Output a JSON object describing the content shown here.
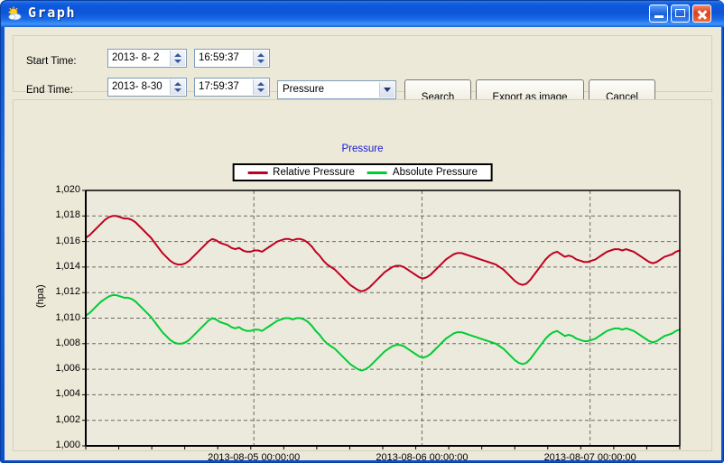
{
  "window": {
    "title": "Graph",
    "icon": "weather-sun-icon",
    "controls": {
      "minimize": "minimize-icon",
      "maximize": "maximize-icon",
      "close": "close-icon"
    }
  },
  "form": {
    "start_label": "Start Time:",
    "end_label": "End Time:",
    "start_date": "2013- 8- 2",
    "start_time": "16:59:37",
    "end_date": "2013- 8-30",
    "end_time": "17:59:37",
    "measure_selected": "Pressure",
    "measure_options": [
      "Pressure"
    ],
    "buttons": {
      "search": "Search",
      "export": "Export as image",
      "cancel": "Cancel"
    }
  },
  "chart_data": {
    "type": "line",
    "title": "Pressure",
    "xlabel": "",
    "ylabel": "(hpa)",
    "ylim": [
      1000,
      1020
    ],
    "ytick_step": 2,
    "yticks": [
      "1,000",
      "1,002",
      "1,004",
      "1,006",
      "1,008",
      "1,010",
      "1,012",
      "1,014",
      "1,016",
      "1,018",
      "1,020"
    ],
    "xticks": [
      "2013-08-05 00:00:00",
      "2013-08-06 00:00:00",
      "2013-08-07 00:00:00"
    ],
    "xtick_fractions": [
      0.283,
      0.566,
      0.849
    ],
    "grid": true,
    "legend_position": "top-center",
    "x_minor_divisions": 18,
    "series": [
      {
        "name": "Relative Pressure",
        "color": "#c00020",
        "values": [
          1016.3,
          1016.5,
          1016.8,
          1017.1,
          1017.4,
          1017.7,
          1017.9,
          1018.0,
          1018.0,
          1017.9,
          1017.8,
          1017.8,
          1017.7,
          1017.5,
          1017.2,
          1016.9,
          1016.6,
          1016.3,
          1015.9,
          1015.5,
          1015.1,
          1014.8,
          1014.5,
          1014.3,
          1014.2,
          1014.2,
          1014.3,
          1014.5,
          1014.8,
          1015.1,
          1015.4,
          1015.7,
          1016.0,
          1016.2,
          1016.1,
          1015.9,
          1015.8,
          1015.7,
          1015.5,
          1015.4,
          1015.5,
          1015.3,
          1015.2,
          1015.2,
          1015.3,
          1015.3,
          1015.2,
          1015.4,
          1015.6,
          1015.8,
          1016.0,
          1016.1,
          1016.2,
          1016.2,
          1016.1,
          1016.2,
          1016.2,
          1016.1,
          1015.9,
          1015.6,
          1015.2,
          1014.9,
          1014.5,
          1014.2,
          1014.0,
          1013.8,
          1013.5,
          1013.2,
          1012.9,
          1012.6,
          1012.4,
          1012.2,
          1012.1,
          1012.2,
          1012.4,
          1012.7,
          1013.0,
          1013.3,
          1013.6,
          1013.8,
          1014.0,
          1014.1,
          1014.1,
          1014.0,
          1013.8,
          1013.6,
          1013.4,
          1013.2,
          1013.1,
          1013.2,
          1013.4,
          1013.7,
          1014.0,
          1014.3,
          1014.6,
          1014.8,
          1015.0,
          1015.1,
          1015.1,
          1015.0,
          1014.9,
          1014.8,
          1014.7,
          1014.6,
          1014.5,
          1014.4,
          1014.3,
          1014.2,
          1014.0,
          1013.8,
          1013.5,
          1013.2,
          1012.9,
          1012.7,
          1012.6,
          1012.7,
          1013.0,
          1013.4,
          1013.8,
          1014.2,
          1014.6,
          1014.9,
          1015.1,
          1015.2,
          1015.0,
          1014.8,
          1014.9,
          1014.8,
          1014.6,
          1014.5,
          1014.4,
          1014.4,
          1014.5,
          1014.6,
          1014.8,
          1015.0,
          1015.2,
          1015.3,
          1015.4,
          1015.4,
          1015.3,
          1015.4,
          1015.3,
          1015.2,
          1015.0,
          1014.8,
          1014.6,
          1014.4,
          1014.3,
          1014.4,
          1014.6,
          1014.8,
          1014.9,
          1015.0,
          1015.2,
          1015.3
        ]
      },
      {
        "name": "Absolute Pressure",
        "color": "#00cc33",
        "values": [
          1010.2,
          1010.4,
          1010.7,
          1011.0,
          1011.3,
          1011.5,
          1011.7,
          1011.8,
          1011.8,
          1011.7,
          1011.6,
          1011.6,
          1011.5,
          1011.3,
          1011.0,
          1010.7,
          1010.4,
          1010.1,
          1009.7,
          1009.3,
          1008.9,
          1008.6,
          1008.3,
          1008.1,
          1008.0,
          1008.0,
          1008.1,
          1008.3,
          1008.6,
          1008.9,
          1009.2,
          1009.5,
          1009.8,
          1010.0,
          1009.9,
          1009.7,
          1009.6,
          1009.5,
          1009.3,
          1009.2,
          1009.3,
          1009.1,
          1009.0,
          1009.0,
          1009.1,
          1009.1,
          1009.0,
          1009.2,
          1009.4,
          1009.6,
          1009.8,
          1009.9,
          1010.0,
          1010.0,
          1009.9,
          1010.0,
          1010.0,
          1009.9,
          1009.7,
          1009.4,
          1009.0,
          1008.7,
          1008.3,
          1008.0,
          1007.8,
          1007.6,
          1007.3,
          1007.0,
          1006.7,
          1006.4,
          1006.2,
          1006.0,
          1005.9,
          1006.0,
          1006.2,
          1006.5,
          1006.8,
          1007.1,
          1007.4,
          1007.6,
          1007.8,
          1007.9,
          1007.9,
          1007.8,
          1007.6,
          1007.4,
          1007.2,
          1007.0,
          1006.9,
          1007.0,
          1007.2,
          1007.5,
          1007.8,
          1008.1,
          1008.4,
          1008.6,
          1008.8,
          1008.9,
          1008.9,
          1008.8,
          1008.7,
          1008.6,
          1008.5,
          1008.4,
          1008.3,
          1008.2,
          1008.1,
          1008.0,
          1007.8,
          1007.6,
          1007.3,
          1007.0,
          1006.7,
          1006.5,
          1006.4,
          1006.5,
          1006.8,
          1007.2,
          1007.6,
          1008.0,
          1008.4,
          1008.7,
          1008.9,
          1009.0,
          1008.8,
          1008.6,
          1008.7,
          1008.6,
          1008.4,
          1008.3,
          1008.2,
          1008.2,
          1008.3,
          1008.4,
          1008.6,
          1008.8,
          1009.0,
          1009.1,
          1009.2,
          1009.2,
          1009.1,
          1009.2,
          1009.1,
          1009.0,
          1008.8,
          1008.6,
          1008.4,
          1008.2,
          1008.1,
          1008.2,
          1008.4,
          1008.6,
          1008.7,
          1008.8,
          1009.0,
          1009.1
        ]
      }
    ]
  }
}
